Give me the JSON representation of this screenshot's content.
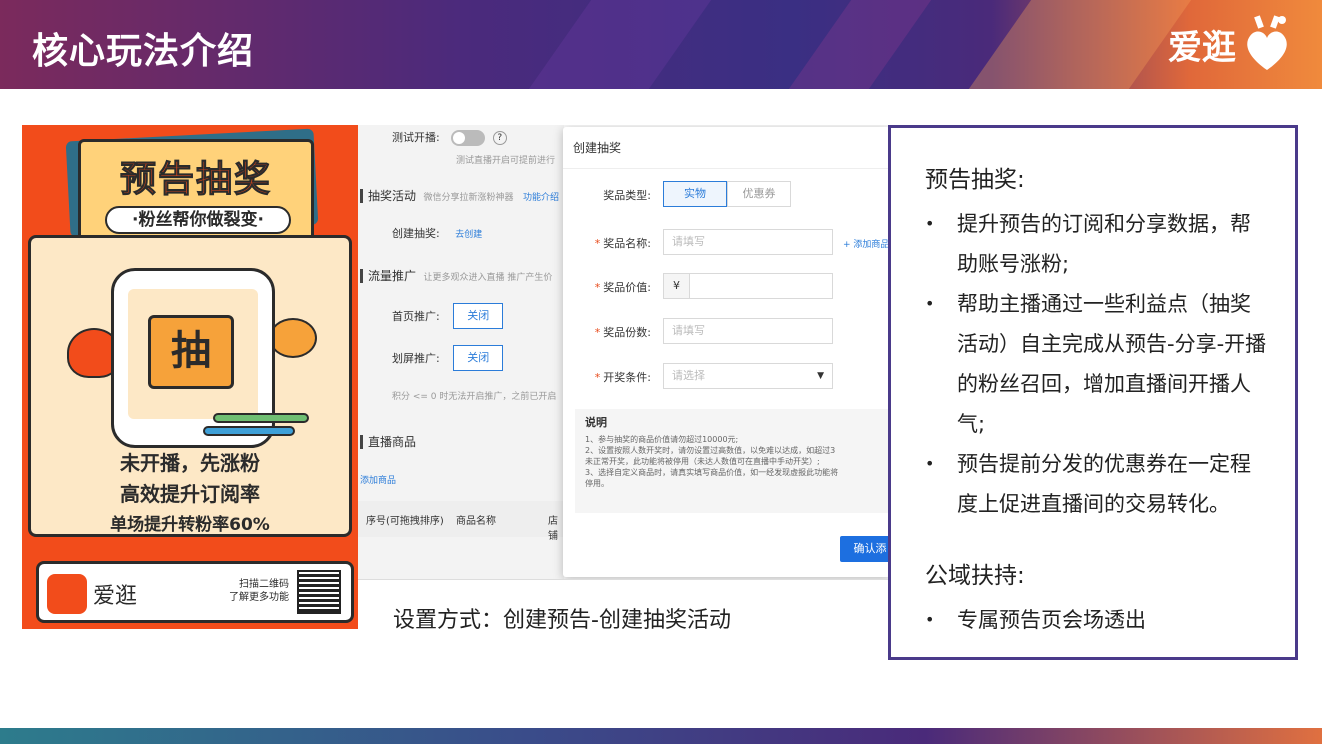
{
  "header": {
    "title": "核心玩法介绍",
    "logo_text": "爱逛"
  },
  "poster": {
    "headline": "预告抽奖",
    "subtitle": "·粉丝帮你做裂变·",
    "center_char": "抽",
    "line1": "未开播，先涨粉",
    "line2": "高效提升订阅率",
    "line3": "单场提升转粉率60%",
    "brand": "爱逛",
    "scan_line1": "扫描二维码",
    "scan_line2": "了解更多功能"
  },
  "admin": {
    "test_live_label": "测试开播:",
    "test_live_hint": "测试直播开启可提前进行",
    "lottery_section": "抽奖活动",
    "lottery_section_hint": "微信分享拉新涨粉神器",
    "feature_intro": "功能介绍",
    "create_lottery_label": "创建抽奖:",
    "create_lottery_link": "去创建",
    "traffic_section": "流量推广",
    "traffic_hint": "让更多观众进入直播  推广产生价",
    "home_promo_label": "首页推广:",
    "home_promo_btn": "关闭",
    "screen_promo_label": "划屏推广:",
    "screen_promo_btn": "关闭",
    "points_hint": "积分 <= 0 时无法开启推广，之前已开启",
    "products_section": "直播商品",
    "add_product": "添加商品",
    "col_seq": "序号(可拖拽排序)",
    "col_name": "商品名称",
    "col_store": "店铺"
  },
  "modal": {
    "title": "创建抽奖",
    "prize_type_label": "奖品类型:",
    "prize_type_options": [
      "实物",
      "优惠券"
    ],
    "prize_name_label": "奖品名称:",
    "prize_name_placeholder": "请填写",
    "add_product_link": "+ 添加商品",
    "prize_value_label": "奖品价值:",
    "currency": "¥",
    "prize_count_label": "奖品份数:",
    "prize_count_placeholder": "请填写",
    "draw_condition_label": "开奖条件:",
    "draw_condition_placeholder": "请选择",
    "note_title": "说明",
    "note_1": "1、参与抽奖的商品价值请勿超过10000元;",
    "note_2": "2、设置按照人数开奖时，请勿设置过高数值，以免难以达成，如超过3",
    "note_2b": "未正常开奖，此功能将被停用（未达人数值可在直播中手动开奖）;",
    "note_3": "3、选择自定义商品时，请真实填写商品价值，如一经发现虚报此功能将",
    "note_3b": "停用。",
    "confirm_btn": "确认添"
  },
  "caption": "设置方式：创建预告-创建抽奖活动",
  "panel": {
    "heading1": "预告抽奖:",
    "bullets1": [
      "提升预告的订阅和分享数据，帮助账号涨粉;",
      "帮助主播通过一些利益点（抽奖活动）自主完成从预告-分享-开播的粉丝召回，增加直播间开播人气;",
      "预告提前分发的优惠券在一定程度上促进直播间的交易转化。"
    ],
    "heading2": "公域扶持:",
    "bullets2": [
      "专属预告页会场透出"
    ]
  },
  "colors": {
    "accent_orange": "#f24c1b",
    "panel_border": "#4a3a8a",
    "link_blue": "#2b7cd9"
  }
}
